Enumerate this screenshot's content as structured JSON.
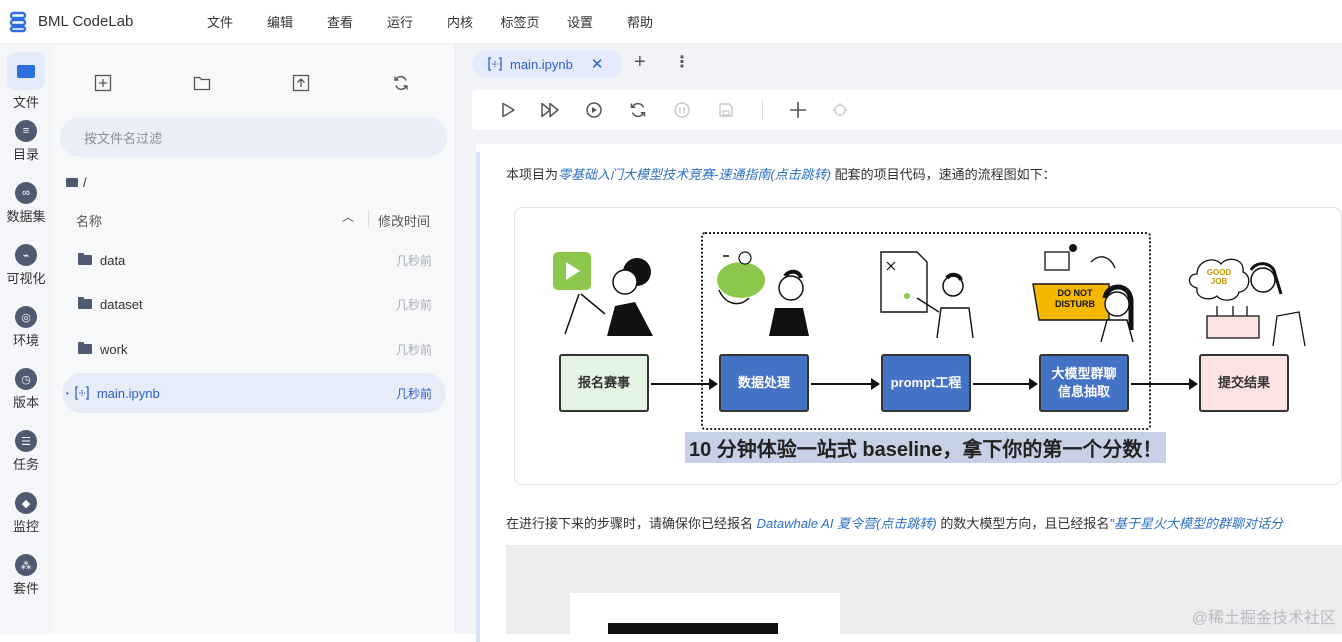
{
  "app": {
    "title": "BML CodeLab"
  },
  "menu": [
    "文件",
    "编辑",
    "查看",
    "运行",
    "内核",
    "标签页",
    "设置",
    "帮助"
  ],
  "leftbar": [
    {
      "label": "文件",
      "icon": "folder-icon"
    },
    {
      "label": "目录",
      "icon": "toc-icon"
    },
    {
      "label": "数据集",
      "icon": "dataset-icon"
    },
    {
      "label": "可视化",
      "icon": "chart-icon"
    },
    {
      "label": "环境",
      "icon": "environment-icon"
    },
    {
      "label": "版本",
      "icon": "clock-icon"
    },
    {
      "label": "任务",
      "icon": "task-icon"
    },
    {
      "label": "监控",
      "icon": "monitor-icon"
    },
    {
      "label": "套件",
      "icon": "suite-icon"
    }
  ],
  "filepanel": {
    "filter_placeholder": "按文件名过滤",
    "breadcrumb": "/",
    "col_name": "名称",
    "col_modified": "修改时间",
    "files": [
      {
        "name": "data",
        "time": "几秒前",
        "type": "folder"
      },
      {
        "name": "dataset",
        "time": "几秒前",
        "type": "folder"
      },
      {
        "name": "work",
        "time": "几秒前",
        "type": "folder"
      },
      {
        "name": "main.ipynb",
        "time": "几秒前",
        "type": "notebook"
      }
    ]
  },
  "tabs": [
    {
      "label": "main.ipynb"
    }
  ],
  "notebook": {
    "p1_prefix": "本项目为",
    "p1_link": "零基础入门大模型技术竞赛-速通指南(点击跳转)",
    "p1_suffix": " 配套的项目代码，速通的流程图如下：",
    "flow": {
      "steps": [
        "报名赛事",
        "数据处理",
        "prompt工程",
        "大模型群聊",
        "信息抽取",
        "提交结果"
      ],
      "dnd_sign_line1": "DO NOT",
      "dnd_sign_line2": "DISTURB",
      "caption": "10 分钟体验一站式 baseline，拿下你的第一个分数！"
    },
    "p2_prefix": "在进行接下来的步骤时，请确保你已经报名 ",
    "p2_link1": "Datawhale AI 夏令营(点击跳转)",
    "p2_mid": " 的数大模型方向，且已经报名",
    "p2_link2": "\"基于星火大模型的群聊对话分"
  },
  "watermark": "@稀土掘金技术社区",
  "colors": {
    "accent": "#2d5fc4",
    "box_green": "#e3f4e3",
    "box_blue": "#4472c4",
    "box_pink": "#fde2e2"
  }
}
